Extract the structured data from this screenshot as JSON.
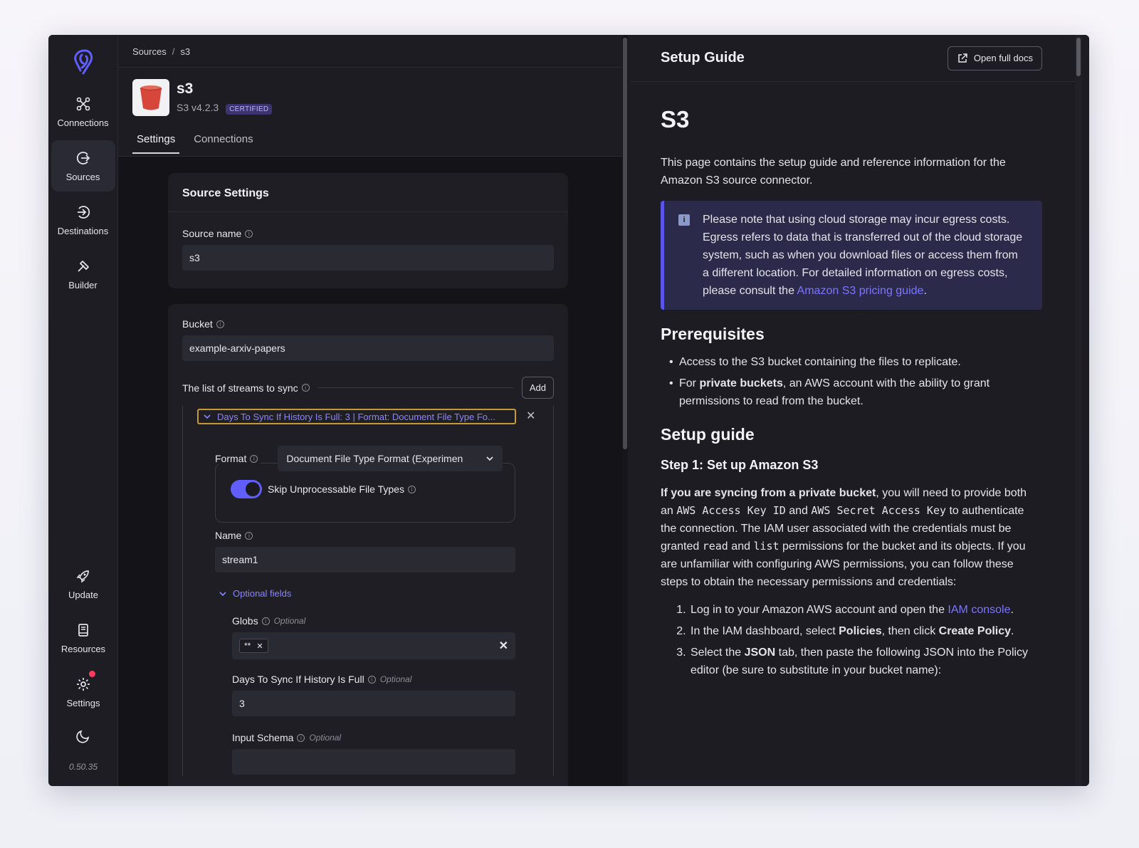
{
  "sidebar": {
    "items": [
      {
        "label": "Connections",
        "icon": "connections-icon"
      },
      {
        "label": "Sources",
        "icon": "sources-icon"
      },
      {
        "label": "Destinations",
        "icon": "destinations-icon"
      },
      {
        "label": "Builder",
        "icon": "builder-icon"
      }
    ],
    "bottom": [
      {
        "label": "Update",
        "icon": "rocket-icon"
      },
      {
        "label": "Resources",
        "icon": "book-icon"
      },
      {
        "label": "Settings",
        "icon": "gear-icon"
      }
    ],
    "version": "0.50.35"
  },
  "breadcrumb": {
    "root": "Sources",
    "separator": "/",
    "current": "s3"
  },
  "source": {
    "name": "s3",
    "version": "S3 v4.2.3",
    "badge": "CERTIFIED"
  },
  "tabs": [
    "Settings",
    "Connections"
  ],
  "settings_card": {
    "title": "Source Settings",
    "source_name_label": "Source name",
    "source_name_value": "s3"
  },
  "bucket": {
    "label": "Bucket",
    "value": "example-arxiv-papers"
  },
  "streams": {
    "label": "The list of streams to sync",
    "add_label": "Add",
    "summary": "Days To Sync If History Is Full: 3 | Format: Document File Type Fo...",
    "format_label": "Format",
    "format_value": "Document File Type Format (Experimen",
    "skip_label": "Skip Unprocessable File Types",
    "skip_enabled": true,
    "name_label": "Name",
    "name_value": "stream1",
    "optional_fields_label": "Optional fields",
    "globs_label": "Globs",
    "globs_chip": "**",
    "optional_tag": "Optional",
    "days_label": "Days To Sync If History Is Full",
    "days_value": "3",
    "schema_label": "Input Schema",
    "schema_value": ""
  },
  "guide": {
    "header": "Setup Guide",
    "open_docs": "Open full docs",
    "h1": "S3",
    "intro": "This page contains the setup guide and reference information for the Amazon S3 source connector.",
    "note_text": "Please note that using cloud storage may incur egress costs. Egress refers to data that is transferred out of the cloud storage system, such as when you download files or access them from a different location. For detailed information on egress costs, please consult the",
    "note_link": "Amazon S3 pricing guide",
    "note_end": ".",
    "prereq_title": "Prerequisites",
    "prereq_1": "Access to the S3 bucket containing the files to replicate.",
    "prereq_2_pre": "For ",
    "prereq_2_bold": "private buckets",
    "prereq_2_post": ", an AWS account with the ability to grant permissions to read from the bucket.",
    "setup_title": "Setup guide",
    "step1_title": "Step 1: Set up Amazon S3",
    "p_bold": "If you are syncing from a private bucket",
    "p_1": ", you will need to provide both an ",
    "code_1": "AWS Access Key ID",
    "p_2": " and ",
    "code_2": "AWS Secret Access Key",
    "p_3": " to authenticate the connection. The IAM user associated with the credentials must be granted ",
    "code_3": "read",
    "p_4": " and ",
    "code_4": "list",
    "p_5": " permissions for the bucket and its objects. If you are unfamiliar with configuring AWS permissions, you can follow these steps to obtain the necessary permissions and credentials:",
    "ol_1_pre": "Log in to your Amazon AWS account and open the ",
    "ol_1_link": "IAM console",
    "ol_1_end": ".",
    "ol_2_pre": "In the IAM dashboard, select ",
    "ol_2_b1": "Policies",
    "ol_2_mid": ", then click ",
    "ol_2_b2": "Create Policy",
    "ol_2_end": ".",
    "ol_3_pre": "Select the ",
    "ol_3_b": "JSON",
    "ol_3_post": " tab, then paste the following JSON into the Policy editor (be sure to substitute in your bucket name):"
  },
  "colors": {
    "accent": "#615eff",
    "link": "#7c75ff",
    "note_bg": "#2c2a4a",
    "highlight": "#c79a33"
  }
}
